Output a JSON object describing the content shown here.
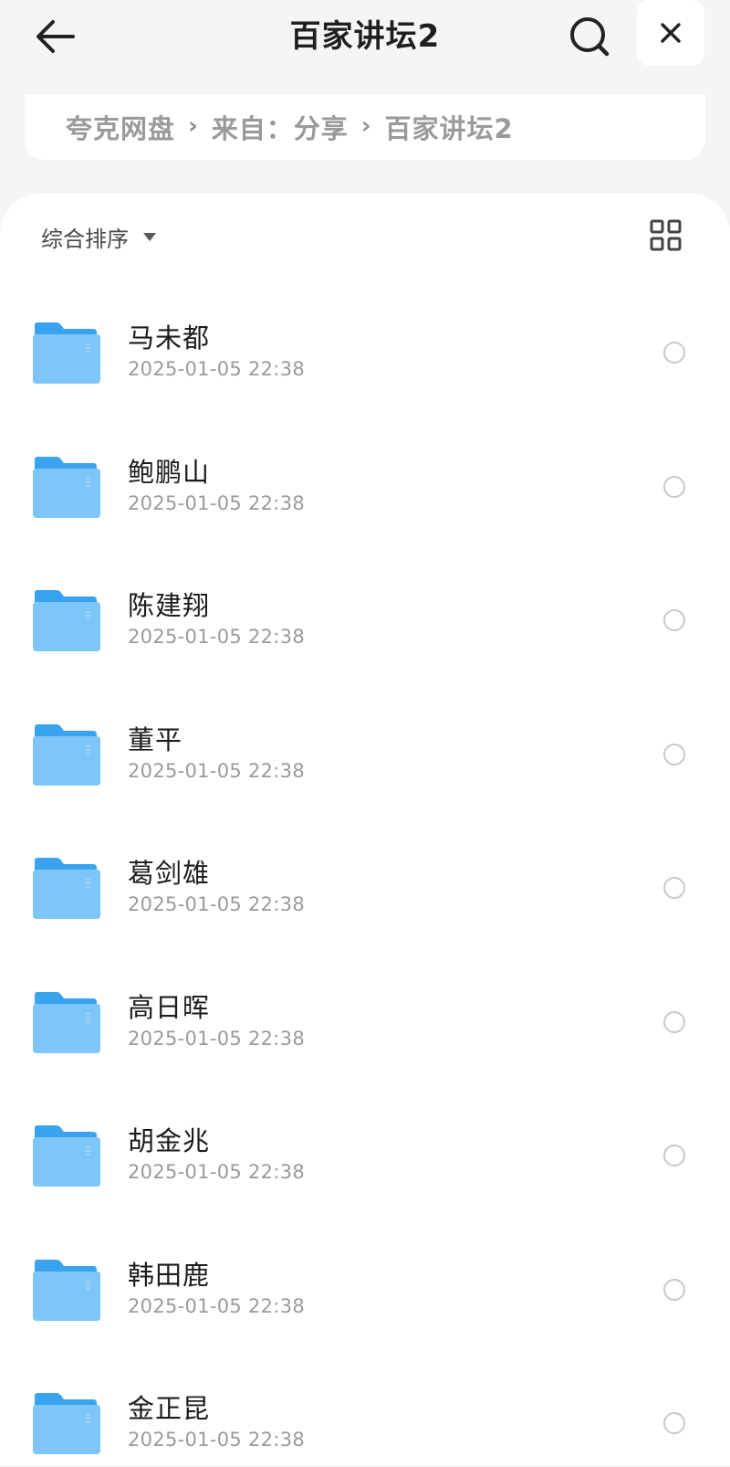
{
  "header": {
    "title": "百家讲坛2",
    "icons": {
      "back": "arrow-left-icon",
      "search": "search-icon",
      "close": "close-icon"
    }
  },
  "breadcrumb": {
    "items": [
      "夸克网盘",
      "来自：分享",
      "百家讲坛2"
    ],
    "separator": "›"
  },
  "toolbar": {
    "sort_label": "综合排序",
    "view_icon": "grid-view-icon"
  },
  "files": [
    {
      "name": "马未都",
      "date": "2025-01-05 22:38"
    },
    {
      "name": "鲍鹏山",
      "date": "2025-01-05 22:38"
    },
    {
      "name": "陈建翔",
      "date": "2025-01-05 22:38"
    },
    {
      "name": "董平",
      "date": "2025-01-05 22:38"
    },
    {
      "name": "葛剑雄",
      "date": "2025-01-05 22:38"
    },
    {
      "name": "高日晖",
      "date": "2025-01-05 22:38"
    },
    {
      "name": "胡金兆",
      "date": "2025-01-05 22:38"
    },
    {
      "name": "韩田鹿",
      "date": "2025-01-05 22:38"
    },
    {
      "name": "金正昆",
      "date": "2025-01-05 22:38"
    }
  ],
  "colors": {
    "background": "#f3f5f7",
    "folder_front": "#7ec6f7",
    "folder_back": "#3aa3ef",
    "radio_border": "#c9c9c9"
  }
}
